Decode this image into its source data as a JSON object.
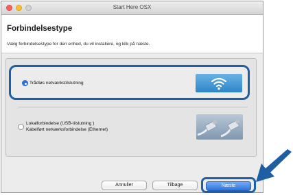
{
  "window": {
    "title": "Start Here OSX"
  },
  "header": {
    "heading": "Forbindelsestype",
    "instruction": "Vælg forbindelsestype for den enhed, du vil installere, og klik på næste."
  },
  "options": [
    {
      "label": "Trådløs netværkstilslutning",
      "selected": true,
      "icon": "wifi-icon"
    },
    {
      "label_line1": "Lokalforbindelse (USB-tilslutning )",
      "label_line2": "Kabelført netværksforbindelse (Ethernet)",
      "selected": false,
      "icon": "cable-icon"
    }
  ],
  "buttons": {
    "cancel": "Annuller",
    "back": "Tilbage",
    "next": "Næste"
  },
  "colors": {
    "highlight": "#1e5fa3",
    "primary_button": "#2f74dc"
  }
}
